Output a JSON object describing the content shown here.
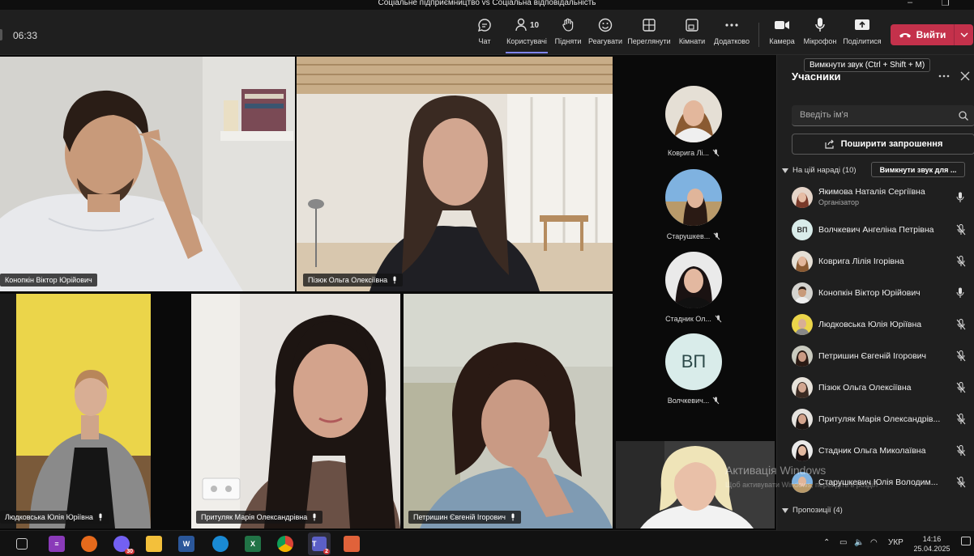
{
  "window": {
    "title": "Соціальне підприємництво vs Соціальна відповідальність"
  },
  "toolbar": {
    "timer": "06:33",
    "chat": "Чат",
    "people": "Користувачі",
    "people_count": "10",
    "raise": "Підняти",
    "react": "Реагувати",
    "view": "Переглянути",
    "rooms": "Кімнати",
    "more": "Додатково",
    "camera": "Камера",
    "mic": "Мікрофон",
    "share": "Поділитися",
    "leave": "Вийти"
  },
  "tooltip": "Вимкнути звук (Ctrl + Shift + M)",
  "video_tiles": [
    {
      "name": "Конопкін Віктор Юрійович"
    },
    {
      "name": "Пізюк Ольга Олексіївна"
    },
    {
      "name": "Людковська Юлія Юріївна"
    },
    {
      "name": "Притуляк Марія Олександрівна"
    },
    {
      "name": "Петришин Євгеній Ігорович"
    }
  ],
  "roster": [
    {
      "name": "Коврига Лі..."
    },
    {
      "name": "Старушкев..."
    },
    {
      "name": "Стадник Ол..."
    },
    {
      "name": "Волчкевич...",
      "initials": "ВП"
    }
  ],
  "panel": {
    "title": "Учасники",
    "search_placeholder": "Введіть ім'я",
    "share_invite": "Поширити запрошення",
    "in_meeting": "На цій нараді (10)",
    "mute_all": "Вимкнути звук для ...",
    "suggestions": "Пропозиції (4)",
    "participants": [
      {
        "name": "Якимова Наталія Сергіївна",
        "role": "Організатор",
        "mic": "on"
      },
      {
        "name": "Волчкевич Ангеліна Петрівна",
        "initials": "ВП",
        "mic": "off"
      },
      {
        "name": "Коврига Лілія Ігорівна",
        "mic": "off"
      },
      {
        "name": "Конопкін Віктор Юрійович",
        "mic": "on"
      },
      {
        "name": "Людковська Юлія Юріївна",
        "mic": "off"
      },
      {
        "name": "Петришин Євгеній Ігорович",
        "mic": "off"
      },
      {
        "name": "Пізюк Ольга Олексіївна",
        "mic": "off"
      },
      {
        "name": "Притуляк Марія Олександрів...",
        "mic": "off"
      },
      {
        "name": "Стадник Ольга Миколаївна",
        "mic": "off"
      },
      {
        "name": "Старушкевич Юлія Володим...",
        "mic": "off"
      }
    ]
  },
  "watermark": {
    "line1": "Активація Windows",
    "line2": "Щоб активувати Windows, перейдіть в розділ"
  },
  "taskbar": {
    "lang": "УКР",
    "time": "14:16",
    "date": "25.04.2025",
    "badge_teams": "2",
    "badge_viber": "30"
  },
  "colors": {
    "accent": "#7f85f5",
    "leave": "#c4314b",
    "panel": "#1f1f1f",
    "toolbar": "#1f1f1f"
  }
}
